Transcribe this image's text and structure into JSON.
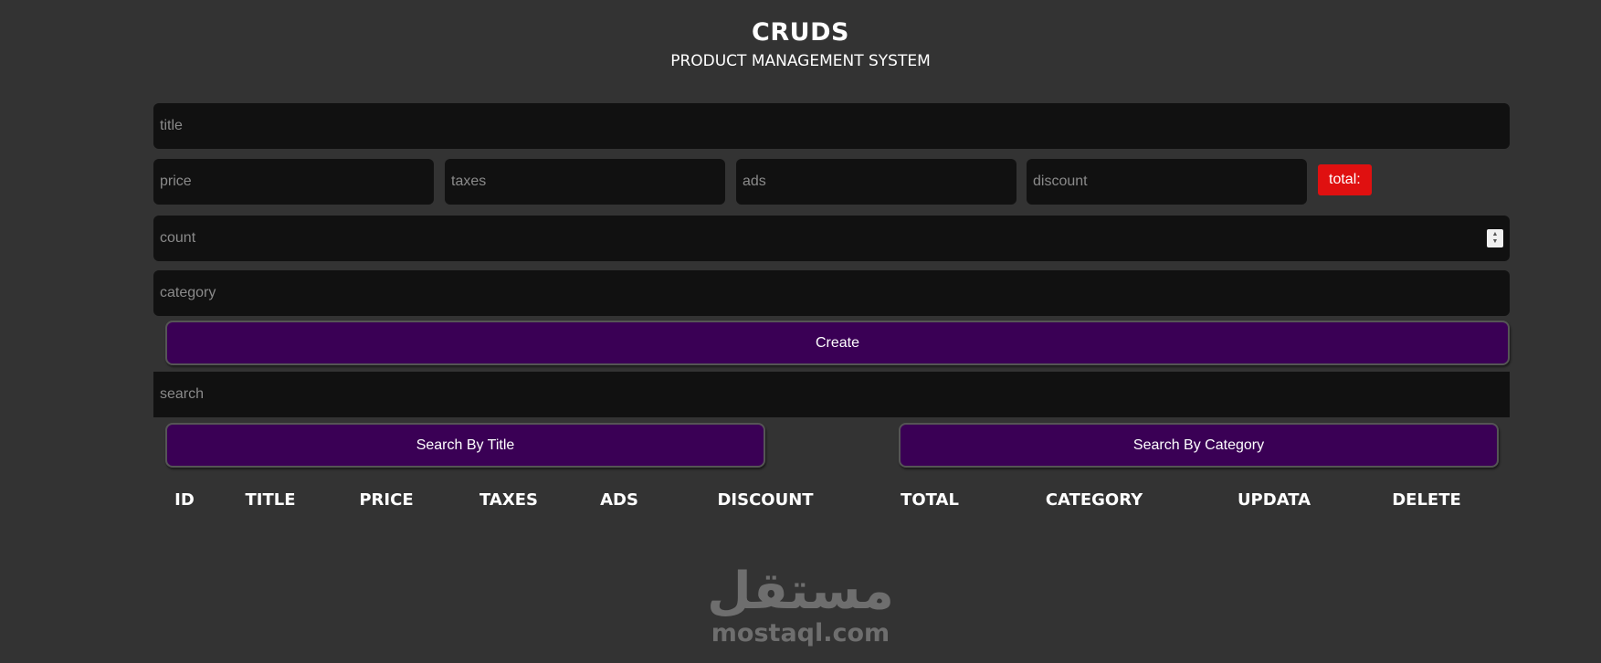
{
  "header": {
    "title": "CRUDS",
    "subtitle": "PRODUCT MANAGEMENT SYSTEM"
  },
  "form": {
    "title_placeholder": "title",
    "price_placeholder": "price",
    "taxes_placeholder": "taxes",
    "ads_placeholder": "ads",
    "discount_placeholder": "discount",
    "total_label": "total:",
    "count_placeholder": "count",
    "category_placeholder": "category",
    "create_label": "Create"
  },
  "search": {
    "placeholder": "search",
    "by_title_label": "Search By Title",
    "by_category_label": "Search By Category"
  },
  "table": {
    "headers": [
      "ID",
      "TITLE",
      "PRICE",
      "TAXES",
      "ADS",
      "DISCOUNT",
      "TOTAL",
      "CATEGORY",
      "UPDATA",
      "DELETE"
    ]
  },
  "watermark": {
    "arabic": "مستقل",
    "latin": "mostaql.com"
  },
  "colors": {
    "background": "#333333",
    "input_bg": "#111111",
    "button_bg": "#3a0055",
    "total_bg": "#e01010"
  }
}
